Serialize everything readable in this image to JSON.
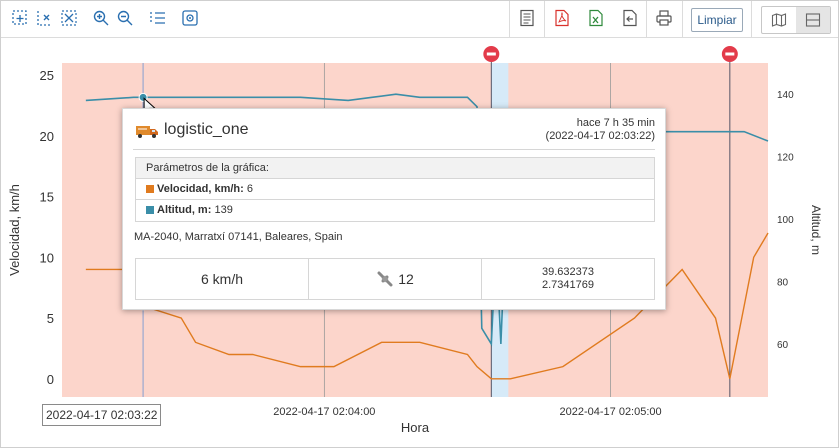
{
  "toolbar": {
    "left_icons": [
      "zoom-select-icon",
      "zoom-x-icon",
      "fit-all-icon",
      "zoom-in-icon",
      "zoom-out-icon",
      "list-icon",
      "target-icon"
    ],
    "right_icons": [
      "document-icon",
      "pdf-icon",
      "excel-icon",
      "export-icon",
      "print-icon"
    ],
    "clear_label": "Limpiar",
    "view_icons": [
      "map-icon",
      "split-view-icon"
    ]
  },
  "chart_data": {
    "type": "line",
    "xlabel": "Hora",
    "ylabel_left": "Velocidad, km/h",
    "ylabel_right": "Altitud, m",
    "x_ticks": [
      "2022-04-17 02:04:00",
      "2022-04-17 02:05:00"
    ],
    "x_range": [
      "2022-04-17 02:03:05",
      "2022-04-17 02:05:33"
    ],
    "y_left_ticks": [
      0,
      5,
      10,
      15,
      20,
      25
    ],
    "y_left_range": [
      -1.5,
      26
    ],
    "y_right_ticks": [
      60,
      80,
      100,
      120,
      140
    ],
    "y_right_range": [
      43,
      150
    ],
    "highlight_x": "2022-04-17 02:03:22",
    "event_markers": [
      "2022-04-17 02:04:35",
      "2022-04-17 02:05:25"
    ],
    "series": [
      {
        "name": "Velocidad, km/h",
        "axis": "left",
        "color": "#e07b1f",
        "x": [
          "02:03:10",
          "02:03:20",
          "02:03:22",
          "02:03:30",
          "02:03:33",
          "02:03:40",
          "02:03:45",
          "02:03:55",
          "02:04:02",
          "02:04:12",
          "02:04:20",
          "02:04:30",
          "02:04:32",
          "02:04:35",
          "02:04:36",
          "02:04:37",
          "02:04:39",
          "02:04:50",
          "02:05:05",
          "02:05:15",
          "02:05:22",
          "02:05:25",
          "02:05:30",
          "02:05:33"
        ],
        "values": [
          9,
          9,
          6,
          5,
          3,
          2,
          2,
          1,
          1,
          3,
          3,
          2,
          1,
          0,
          0,
          0,
          0,
          1,
          5,
          9,
          5,
          0,
          10,
          12
        ]
      },
      {
        "name": "Altitud, m",
        "axis": "right",
        "color": "#3a8ea8",
        "x": [
          "02:03:10",
          "02:03:20",
          "02:03:22",
          "02:03:30",
          "02:03:40",
          "02:03:50",
          "02:03:55",
          "02:04:05",
          "02:04:10",
          "02:04:15",
          "02:04:20",
          "02:04:30",
          "02:04:32",
          "02:04:33",
          "02:04:35",
          "02:04:36",
          "02:04:37",
          "02:04:39",
          "02:04:50",
          "02:05:00",
          "02:05:10",
          "02:05:20",
          "02:05:28",
          "02:05:33"
        ],
        "values": [
          138,
          139,
          139,
          139,
          139,
          139,
          139,
          138,
          139,
          140,
          139,
          139,
          136,
          65,
          60,
          92,
          60,
          134,
          134,
          133,
          128,
          128,
          128,
          125
        ]
      }
    ]
  },
  "tooltip": {
    "unit_name": "logistic_one",
    "ago": "hace 7 h 35 min",
    "datetime": "(2022-04-17 02:03:22)",
    "params_title": "Parámetros de la gráfica:",
    "speed_label": "Velocidad, km/h:",
    "speed_value": "6",
    "altitude_label": "Altitud, m:",
    "altitude_value": "139",
    "address": "MA-2040, Marratxí 07141, Baleares, Spain",
    "speed_stat": "6 km/h",
    "satellites": "12",
    "lat": "39.632373",
    "lon": "2.7341769"
  },
  "cursor_time_label": "2022-04-17 02:03:22",
  "colors": {
    "plot_background": "#fcd5cb",
    "highlight_band": "#d6eaf8",
    "marker_red": "#e33b4a",
    "speed": "#e07b1f",
    "altitude": "#3a8ea8"
  }
}
